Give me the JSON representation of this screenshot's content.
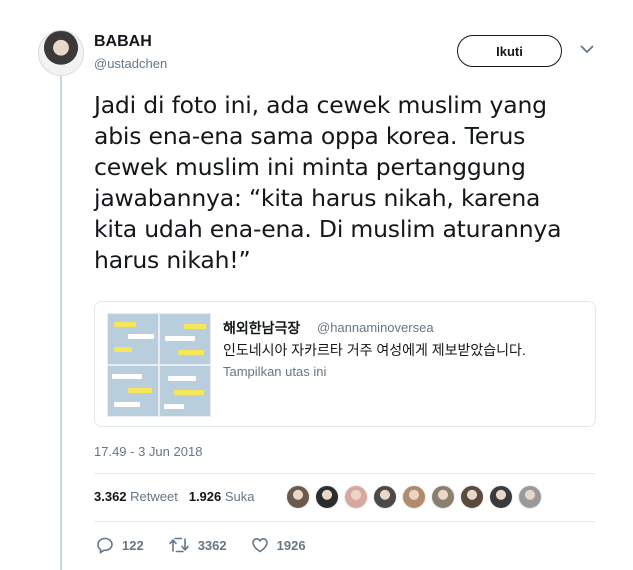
{
  "user": {
    "display_name": "BABAH",
    "handle": "@ustadchen"
  },
  "follow_label": "Ikuti",
  "tweet": {
    "lines": [
      "Jadi di foto ini, ada cewek muslim yang",
      "abis ena-ena sama oppa korea. Terus",
      "cewek muslim ini minta pertanggung",
      "jawabannya: “kita harus nikah, karena",
      "kita udah ena-ena. Di muslim aturannya",
      "harus nikah!”"
    ]
  },
  "quote": {
    "name": "해외한남극장",
    "handle": "@hannaminoversea",
    "text": "인도네시아 자카르타 거주 여성에게 제보받았습니다.",
    "link": "Tampilkan utas ini"
  },
  "timestamp": "17.49 - 3 Jun 2018",
  "stats": {
    "retweets": "3.362",
    "retweet_label": "Retweet",
    "likes": "1.926",
    "like_label": "Suka"
  },
  "actions": {
    "replies": "122",
    "retweets": "3362",
    "likes": "1926"
  },
  "liker_colors": [
    "#6b5b4e",
    "#2c2c2c",
    "#d8a8a0",
    "#4a4a4a",
    "#b08c6c",
    "#8a8070",
    "#5a4a40",
    "#3b3b3b",
    "#9a9a9a"
  ]
}
